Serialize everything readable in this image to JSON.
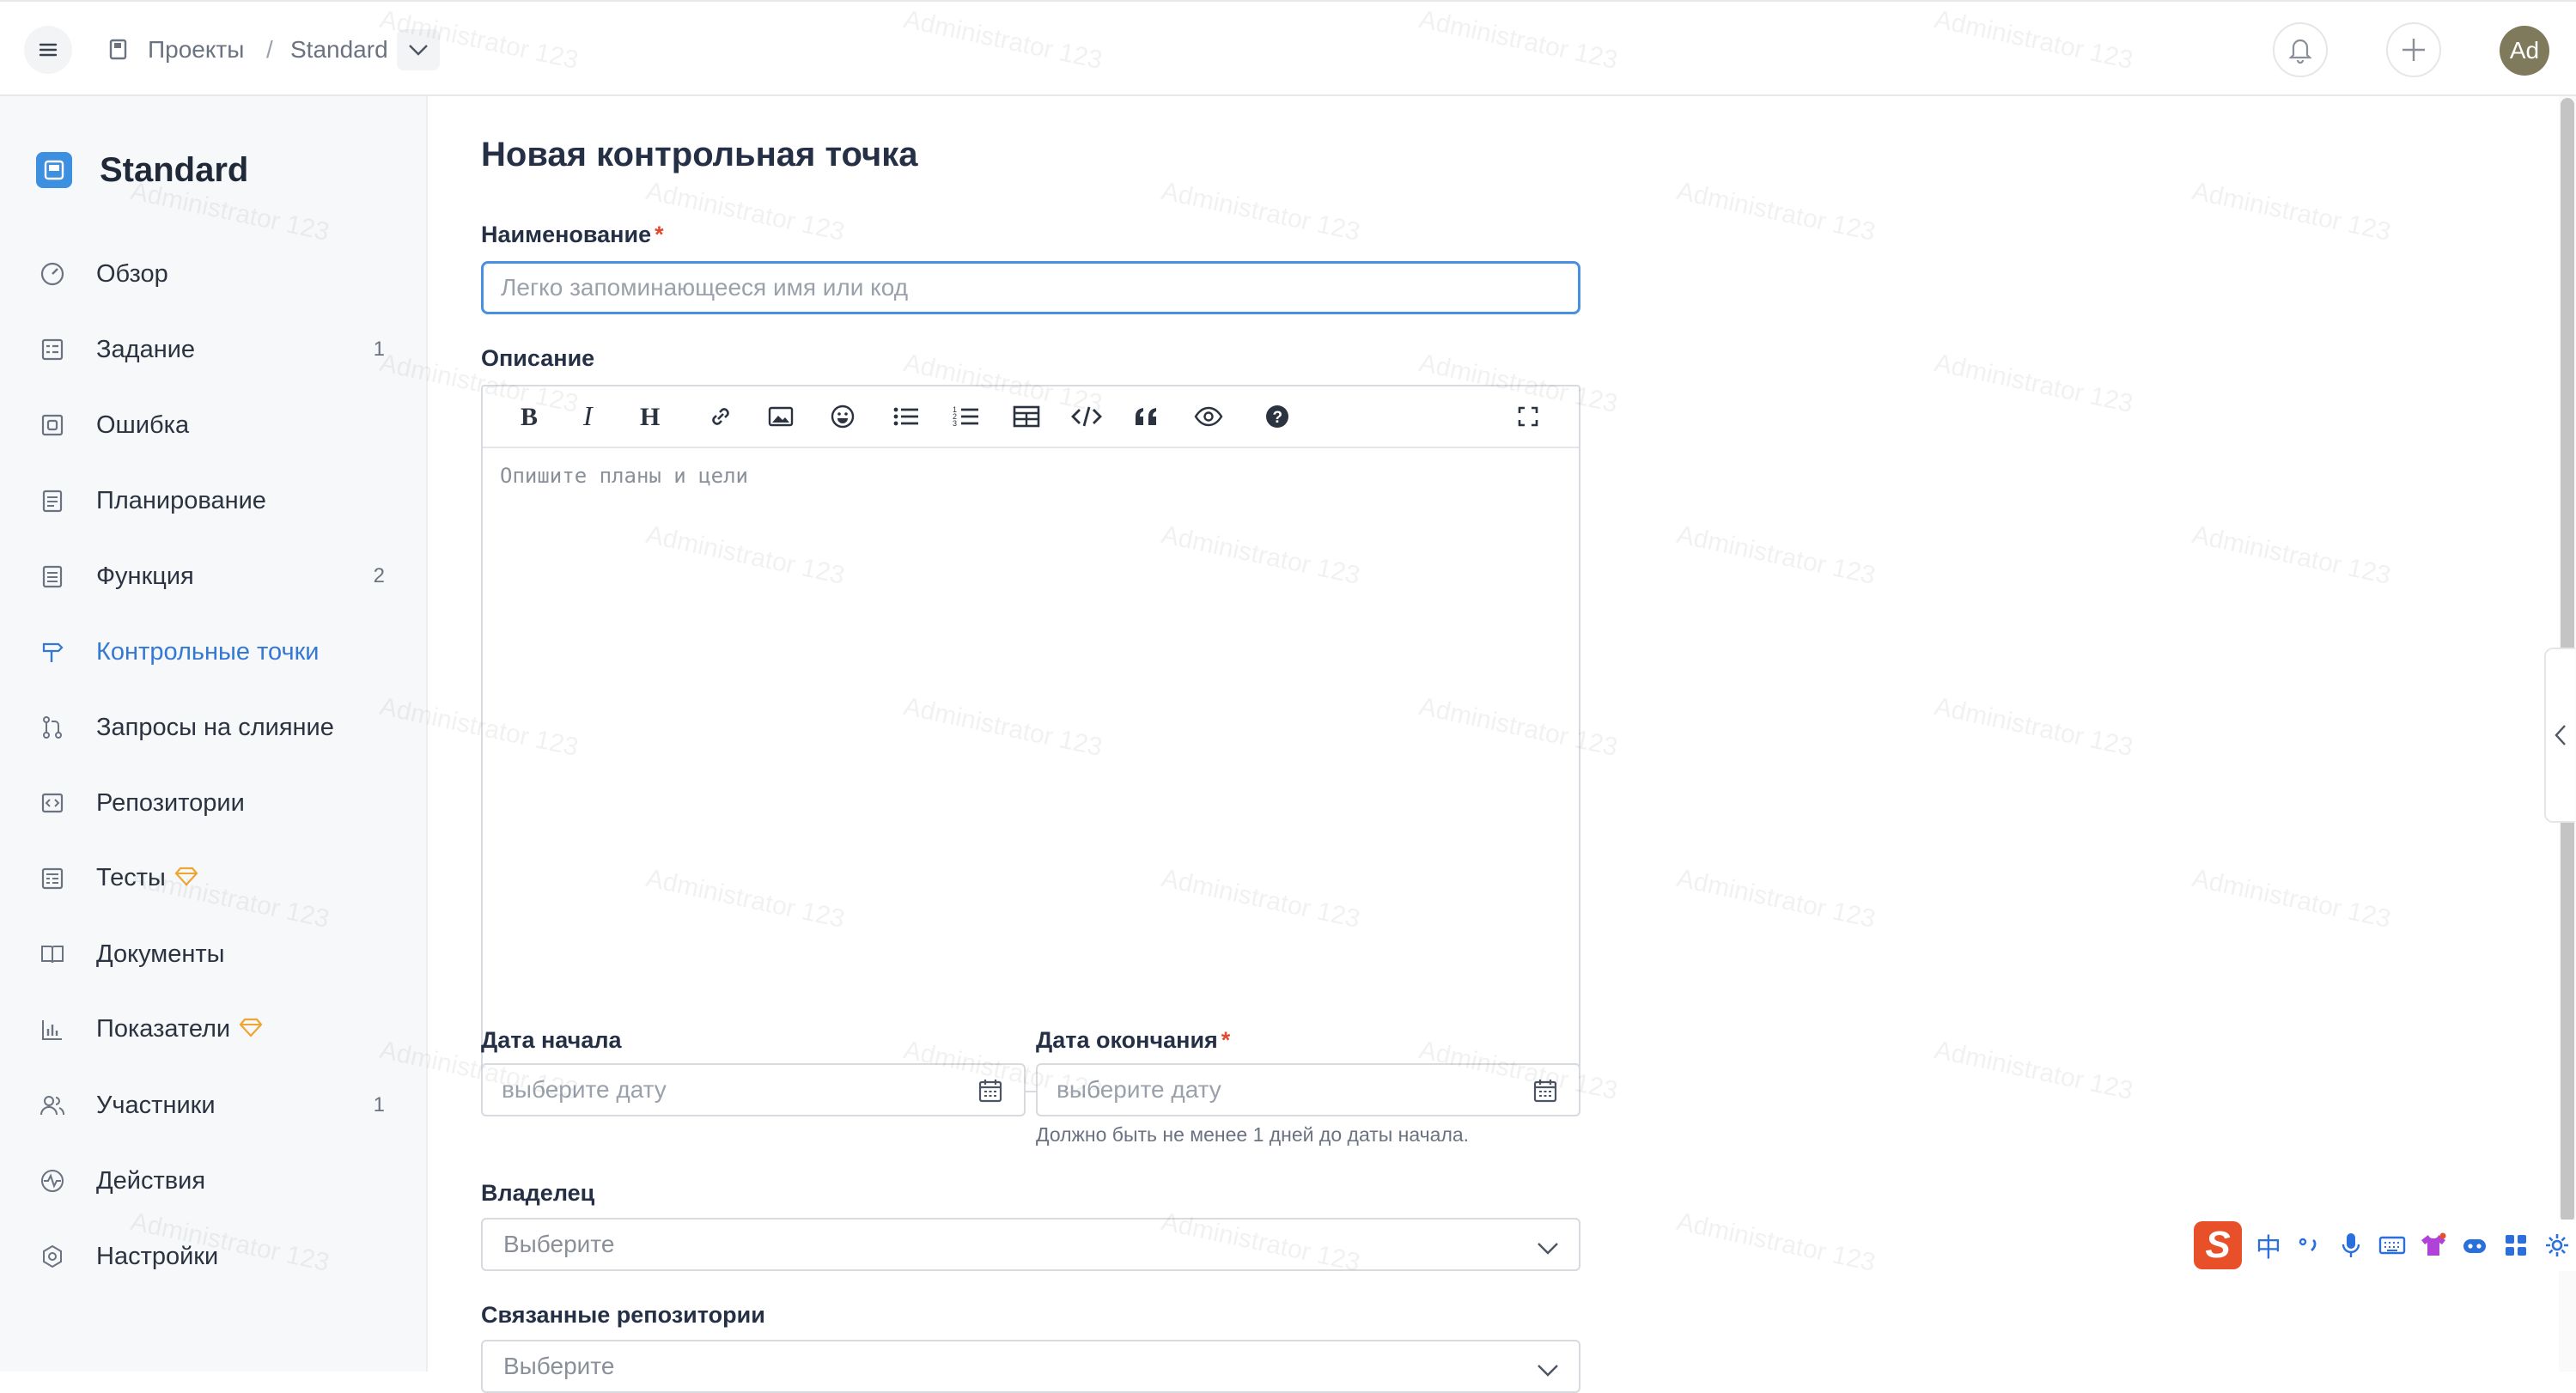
{
  "breadcrumb": {
    "projects": "Проекты",
    "separator": "/",
    "project": "Standard"
  },
  "user": {
    "initials": "Ad"
  },
  "sidebar": {
    "project_name": "Standard",
    "items": [
      {
        "label": "Обзор",
        "icon": "gauge-icon",
        "count": ""
      },
      {
        "label": "Задание",
        "icon": "task-list-icon",
        "count": "1"
      },
      {
        "label": "Ошибка",
        "icon": "bug-icon",
        "count": ""
      },
      {
        "label": "Планирование",
        "icon": "calendar-list-icon",
        "count": ""
      },
      {
        "label": "Функция",
        "icon": "document-icon",
        "count": "2"
      },
      {
        "label": "Контрольные точки",
        "icon": "signpost-icon",
        "count": "",
        "active": true
      },
      {
        "label": "Запросы на слияние",
        "icon": "merge-request-icon",
        "count": ""
      },
      {
        "label": "Репозитории",
        "icon": "code-icon",
        "count": ""
      },
      {
        "label": "Тесты",
        "icon": "test-icon",
        "count": "",
        "premium": true
      },
      {
        "label": "Документы",
        "icon": "book-icon",
        "count": ""
      },
      {
        "label": "Показатели",
        "icon": "bar-chart-icon",
        "count": "",
        "premium": true
      },
      {
        "label": "Участники",
        "icon": "users-icon",
        "count": "1"
      },
      {
        "label": "Действия",
        "icon": "activity-icon",
        "count": ""
      },
      {
        "label": "Настройки",
        "icon": "gear-icon",
        "count": ""
      }
    ]
  },
  "form": {
    "title": "Новая контрольная точка",
    "name": {
      "label": "Наименование",
      "required_mark": "*",
      "placeholder": "Легко запоминающееся имя или код",
      "value": ""
    },
    "description": {
      "label": "Описание",
      "placeholder": "Опишите планы и цели"
    },
    "start_date": {
      "label": "Дата начала",
      "placeholder": "выберите дату"
    },
    "end_date": {
      "label": "Дата окончания",
      "required_mark": "*",
      "placeholder": "выберите дату",
      "hint": "Должно быть не менее 1 дней до даты начала."
    },
    "owner": {
      "label": "Владелец",
      "placeholder": "Выберите"
    },
    "repositories": {
      "label": "Связанные репозитории",
      "placeholder": "Выберите"
    }
  },
  "editor_toolbar": [
    "bold-icon",
    "italic-icon",
    "heading-icon",
    "link-icon",
    "image-icon",
    "emoji-icon",
    "bullet-list-icon",
    "numbered-list-icon",
    "table-icon",
    "code-icon",
    "quote-icon",
    "preview-eye-icon",
    "help-icon",
    "fullscreen-icon"
  ],
  "watermark": "Administrator 123",
  "ime": {
    "logo": "S",
    "lang": "中"
  },
  "colors": {
    "accent": "#3478d6",
    "required": "#e0492d",
    "premium": "#f0a530",
    "focus_border": "#4a90e2"
  }
}
